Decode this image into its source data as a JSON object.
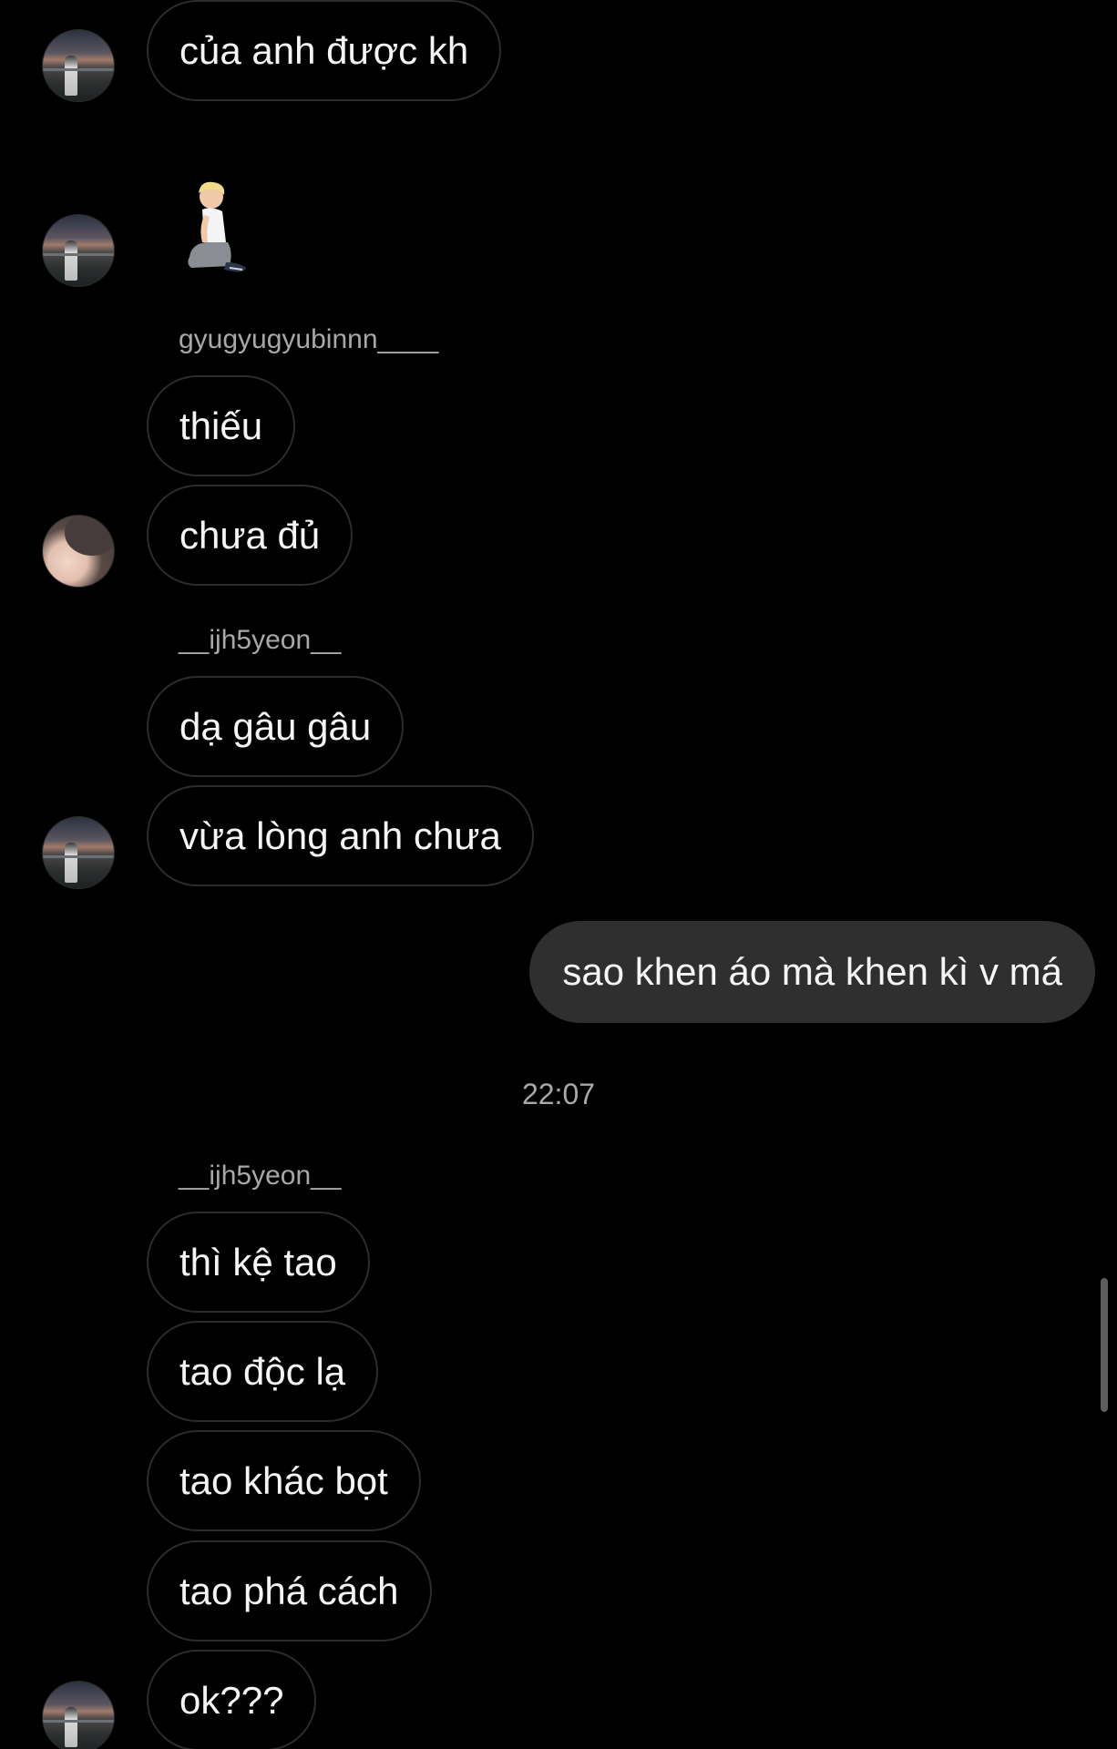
{
  "messages": {
    "m1": "của anh được kh",
    "m2_emoji_name": "person-kneeling",
    "m3": "thiếu",
    "m4": "chưa đủ",
    "m5": "dạ gâu gâu",
    "m6": "vừa lòng anh chưa",
    "m7": "sao khen áo mà khen kì v má",
    "m8": "thì kệ tao",
    "m9": "tao độc lạ",
    "m10": "tao khác bọt",
    "m11": "tao phá cách",
    "m12": "ok???"
  },
  "senders": {
    "s1": "gyugyugyubinnn____",
    "s2": "__ijh5yeon__",
    "s3": "__ijh5yeon__"
  },
  "timestamp": "22:07",
  "colors": {
    "background": "#000000",
    "incoming_border": "#2c2c2e",
    "outgoing_fill": "#2f2f2f",
    "text": "#f5f5f5",
    "meta_text": "#a8a8a8"
  },
  "icons": {
    "avatar_scene": "avatar-sunset-photo",
    "avatar_face": "avatar-face-photo",
    "emoji": "person-kneeling-emoji"
  }
}
